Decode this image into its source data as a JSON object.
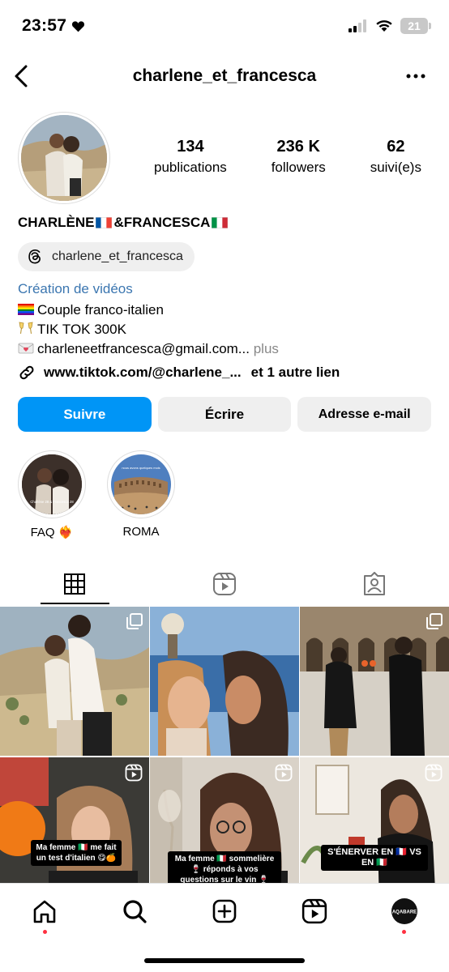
{
  "status": {
    "time": "23:57",
    "battery": "21"
  },
  "header": {
    "username": "charlene_et_francesca"
  },
  "stats": [
    {
      "num": "134",
      "label": "publications"
    },
    {
      "num": "236 K",
      "label": "followers"
    },
    {
      "num": "62",
      "label": "suivi(e)s"
    }
  ],
  "profile": {
    "name_part1": "CHARLÈNE",
    "name_part2": "&FRANCESCA",
    "threads": "charlene_et_francesca",
    "category": "Création de vidéos",
    "bio1": "Couple franco-italien",
    "bio2": "TIK TOK 300K",
    "bio3": "charleneetfrancesca@gmail.com...",
    "more": "plus",
    "link": "www.tiktok.com/@charlene_...",
    "link_more": "et 1 autre lien"
  },
  "buttons": {
    "follow": "Suivre",
    "message": "Écrire",
    "email": "Adresse e-mail"
  },
  "highlights": [
    {
      "label": "FAQ ❤️‍🔥",
      "inner_text": "Charlène 28 & Francesca 28"
    },
    {
      "label": "ROMA",
      "inner_text": "nous avons quelques mois"
    }
  ],
  "grid": [
    {
      "caption": ""
    },
    {
      "caption": ""
    },
    {
      "caption": ""
    },
    {
      "caption": "Ma femme 🇮🇹 me fait un test d'italien 😋🍊"
    },
    {
      "caption": "Ma femme 🇮🇹 sommelière 🍷 réponds à vos questions sur le vin 🍷"
    },
    {
      "caption": "S'ÉNERVER EN 🇫🇷 VS EN 🇮🇹"
    }
  ],
  "nav": {
    "avatar_text": "AQABARE"
  },
  "colors": {
    "primary": "#0095f6",
    "category": "#3b76b0",
    "notif": "#ff3040"
  }
}
